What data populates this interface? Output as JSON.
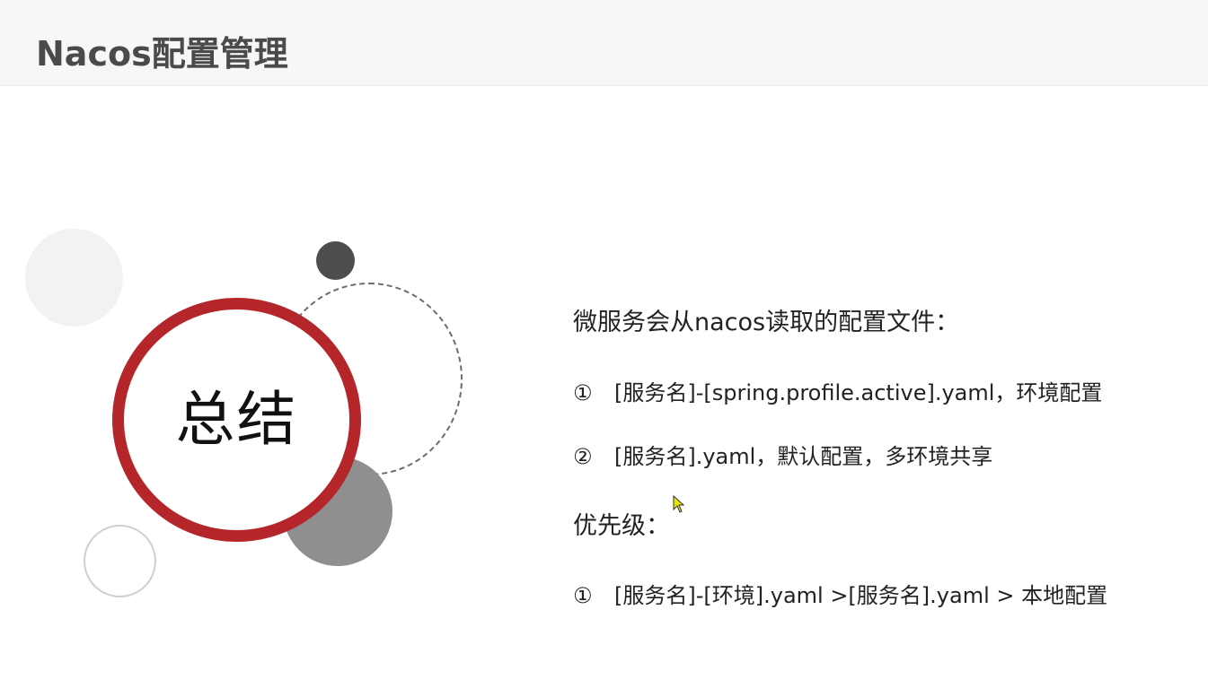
{
  "header": {
    "title": "Nacos配置管理"
  },
  "center": {
    "label": "总结"
  },
  "content": {
    "section1_heading": "微服务会从nacos读取的配置文件：",
    "section1_items": [
      {
        "num": "①",
        "text": "[服务名]-[spring.profile.active].yaml，环境配置"
      },
      {
        "num": "②",
        "text": "[服务名].yaml，默认配置，多环境共享"
      }
    ],
    "section2_heading": "优先级：",
    "section2_items": [
      {
        "num": "①",
        "text": "[服务名]-[环境].yaml >[服务名].yaml > 本地配置"
      }
    ]
  },
  "colors": {
    "accent_ring": "#b5262b",
    "title_text": "#4a4a4a",
    "header_bg": "#f7f7f7"
  },
  "icons": {
    "cursor": "mouse-pointer-icon"
  }
}
